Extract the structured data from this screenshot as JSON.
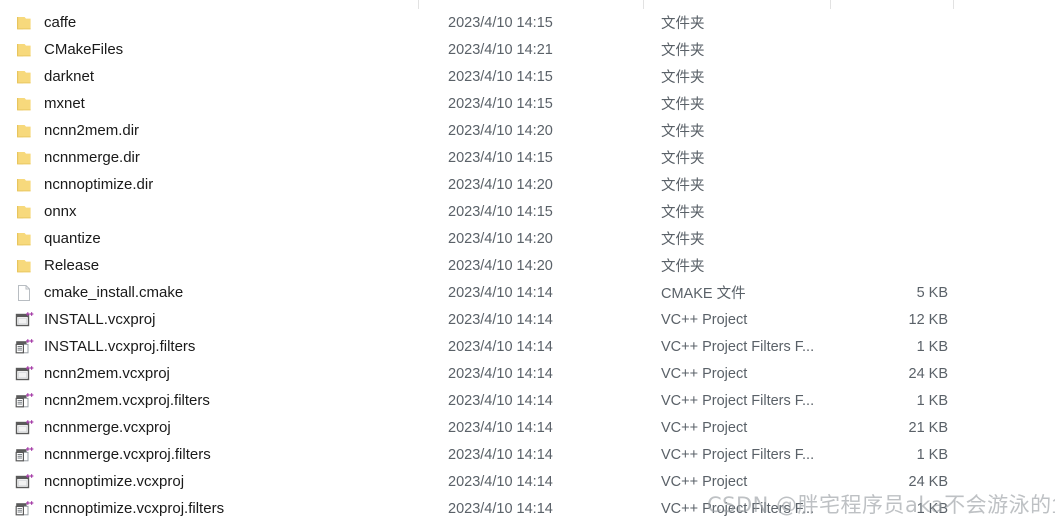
{
  "window": {
    "view": "file-list-details",
    "watermark": "CSDN @胖宅程序员aka不会游泳的鱼"
  },
  "colors": {
    "folder": "#f7d97c",
    "folder_shade": "#e8c55e",
    "text": "#1a1a1a",
    "muted": "#5a6168",
    "separator": "#e2e2e2",
    "vcxproj_frame": "#5a5a5a",
    "plusplus": "#a63fa8",
    "watermark": "#969ba0"
  },
  "columns": {
    "name": "",
    "date_modified": "",
    "type": "",
    "size": ""
  },
  "rows": [
    {
      "name": "caffe",
      "icon": "folder-icon",
      "date": "2023/4/10 14:15",
      "type": "文件夹",
      "size": ""
    },
    {
      "name": "CMakeFiles",
      "icon": "folder-icon",
      "date": "2023/4/10 14:21",
      "type": "文件夹",
      "size": ""
    },
    {
      "name": "darknet",
      "icon": "folder-icon",
      "date": "2023/4/10 14:15",
      "type": "文件夹",
      "size": ""
    },
    {
      "name": "mxnet",
      "icon": "folder-icon",
      "date": "2023/4/10 14:15",
      "type": "文件夹",
      "size": ""
    },
    {
      "name": "ncnn2mem.dir",
      "icon": "folder-icon",
      "date": "2023/4/10 14:20",
      "type": "文件夹",
      "size": ""
    },
    {
      "name": "ncnnmerge.dir",
      "icon": "folder-icon",
      "date": "2023/4/10 14:15",
      "type": "文件夹",
      "size": ""
    },
    {
      "name": "ncnnoptimize.dir",
      "icon": "folder-icon",
      "date": "2023/4/10 14:20",
      "type": "文件夹",
      "size": ""
    },
    {
      "name": "onnx",
      "icon": "folder-icon",
      "date": "2023/4/10 14:15",
      "type": "文件夹",
      "size": ""
    },
    {
      "name": "quantize",
      "icon": "folder-icon",
      "date": "2023/4/10 14:20",
      "type": "文件夹",
      "size": ""
    },
    {
      "name": "Release",
      "icon": "folder-icon",
      "date": "2023/4/10 14:20",
      "type": "文件夹",
      "size": ""
    },
    {
      "name": "cmake_install.cmake",
      "icon": "blank-document-icon",
      "date": "2023/4/10 14:14",
      "type": "CMAKE 文件",
      "size": "5 KB"
    },
    {
      "name": "INSTALL.vcxproj",
      "icon": "vcxproj-icon",
      "date": "2023/4/10 14:14",
      "type": "VC++ Project",
      "size": "12 KB"
    },
    {
      "name": "INSTALL.vcxproj.filters",
      "icon": "vcxproj-filters-icon",
      "date": "2023/4/10 14:14",
      "type": "VC++ Project Filters F...",
      "size": "1 KB"
    },
    {
      "name": "ncnn2mem.vcxproj",
      "icon": "vcxproj-icon",
      "date": "2023/4/10 14:14",
      "type": "VC++ Project",
      "size": "24 KB"
    },
    {
      "name": "ncnn2mem.vcxproj.filters",
      "icon": "vcxproj-filters-icon",
      "date": "2023/4/10 14:14",
      "type": "VC++ Project Filters F...",
      "size": "1 KB"
    },
    {
      "name": "ncnnmerge.vcxproj",
      "icon": "vcxproj-icon",
      "date": "2023/4/10 14:14",
      "type": "VC++ Project",
      "size": "21 KB"
    },
    {
      "name": "ncnnmerge.vcxproj.filters",
      "icon": "vcxproj-filters-icon",
      "date": "2023/4/10 14:14",
      "type": "VC++ Project Filters F...",
      "size": "1 KB"
    },
    {
      "name": "ncnnoptimize.vcxproj",
      "icon": "vcxproj-icon",
      "date": "2023/4/10 14:14",
      "type": "VC++ Project",
      "size": "24 KB"
    },
    {
      "name": "ncnnoptimize.vcxproj.filters",
      "icon": "vcxproj-filters-icon",
      "date": "2023/4/10 14:14",
      "type": "VC++ Project Filters F...",
      "size": "1 KB"
    }
  ]
}
